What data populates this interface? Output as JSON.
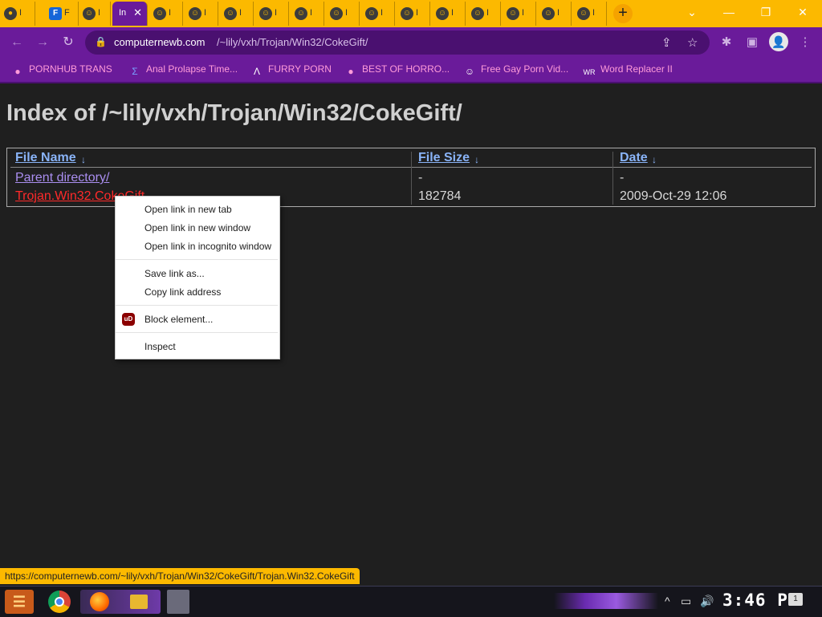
{
  "browser": {
    "tabs": [
      {
        "label": "I",
        "icon": "globe-icon",
        "active": false
      },
      {
        "label": "F",
        "icon": "fbox-icon",
        "active": false
      },
      {
        "label": "I",
        "icon": "troll-icon",
        "active": false
      },
      {
        "label": "In",
        "icon": "",
        "active": true
      },
      {
        "label": "I",
        "icon": "troll-icon",
        "active": false
      },
      {
        "label": "I",
        "icon": "troll-icon",
        "active": false
      },
      {
        "label": "I",
        "icon": "troll-icon",
        "active": false
      },
      {
        "label": "I",
        "icon": "troll-icon",
        "active": false
      },
      {
        "label": "I",
        "icon": "troll-icon",
        "active": false
      },
      {
        "label": "I",
        "icon": "troll-icon",
        "active": false
      },
      {
        "label": "I",
        "icon": "troll-icon",
        "active": false
      },
      {
        "label": "I",
        "icon": "troll-icon",
        "active": false
      },
      {
        "label": "I",
        "icon": "troll-icon",
        "active": false
      },
      {
        "label": "I",
        "icon": "troll-icon",
        "active": false
      },
      {
        "label": "I",
        "icon": "troll-icon",
        "active": false
      },
      {
        "label": "I",
        "icon": "troll-icon",
        "active": false
      },
      {
        "label": "I",
        "icon": "troll-icon",
        "active": false
      }
    ],
    "new_tab_symbol": "+",
    "url_host": "computernewb.com",
    "url_path": "/~lily/vxh/Trojan/Win32/CokeGift/",
    "theme_colors": {
      "tab_strip": "#fcb900",
      "toolbar": "#6a1b9a",
      "bookmark_text": "#ff9bd9"
    }
  },
  "bookmarks": [
    {
      "label": "PORNHUB TRANS",
      "icon": "globe-icon"
    },
    {
      "label": "Anal Prolapse Time...",
      "icon": "flag-icon"
    },
    {
      "label": "FURRY PORN",
      "icon": "arrow-up-icon"
    },
    {
      "label": "BEST OF HORRO...",
      "icon": "globe-icon"
    },
    {
      "label": "Free Gay Porn Vid...",
      "icon": "troll-icon"
    },
    {
      "label": "Word Replacer II",
      "icon": "wr-icon"
    }
  ],
  "page": {
    "title": "Index of /~lily/vxh/Trojan/Win32/CokeGift/",
    "columns": [
      "File Name",
      "File Size",
      "Date"
    ],
    "sort_symbol": "↓",
    "rows": [
      {
        "name": "Parent directory/",
        "size": "-",
        "date": "-"
      },
      {
        "name": "Trojan.Win32.CokeGift",
        "size": "182784",
        "date": "2009-Oct-29 12:06"
      }
    ]
  },
  "context_menu": {
    "items": [
      "Open link in new tab",
      "Open link in new window",
      "Open link in incognito window",
      "Save link as...",
      "Copy link address",
      "Block element...",
      "Inspect"
    ],
    "ublock_icon_text": "uD"
  },
  "status_url": "https://computernewb.com/~lily/vxh/Trojan/Win32/CokeGift/Trojan.Win32.CokeGift",
  "taskbar": {
    "clock": "3:46 PM",
    "notification_count": "1"
  }
}
